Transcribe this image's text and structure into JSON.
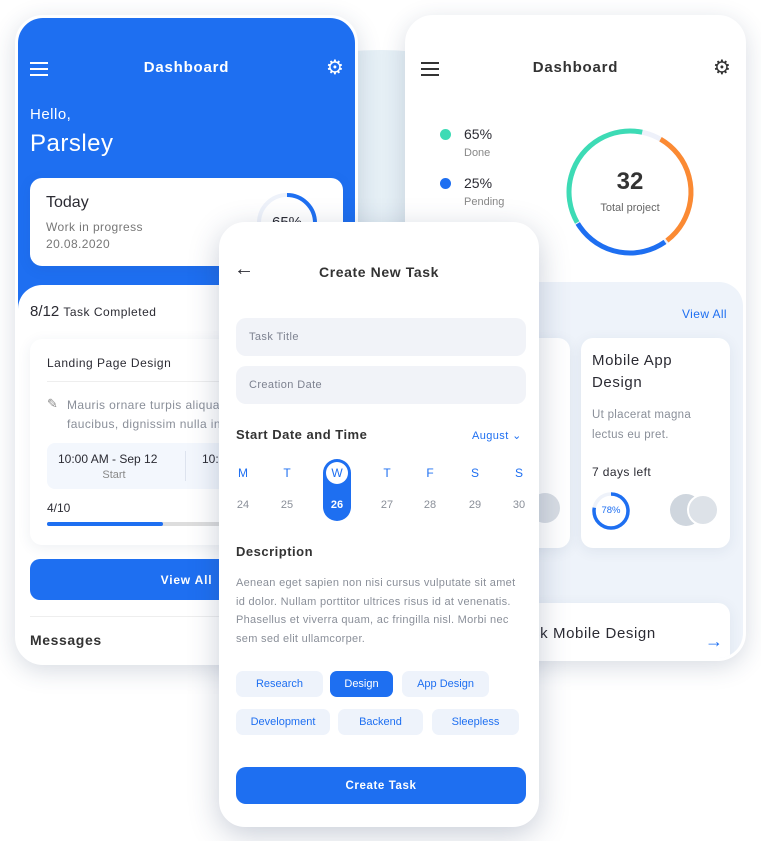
{
  "left": {
    "title": "Dashboard",
    "greeting": "Hello,",
    "name": "Parsley",
    "today": {
      "title": "Today",
      "status": "Work in progress",
      "date": "20.08.2020",
      "percent": "65%",
      "progress": 0.65
    },
    "tasks": {
      "count": "8/12",
      "label": "Task Completed"
    },
    "task_card": {
      "title": "Landing Page Design",
      "desc1": "Mauris ornare turpis aliquam",
      "desc2": "faucibus, dignissim nulla in",
      "start_time": "10:00 AM - Sep 12",
      "start_label": "Start",
      "end_time": "10:",
      "progress_label": "4/10",
      "progress": 0.4
    },
    "view_all": "View All",
    "messages": "Messages"
  },
  "right": {
    "title": "Dashboard",
    "legend": [
      {
        "value": "65%",
        "label": "Done",
        "color": "#3ddbb5"
      },
      {
        "value": "25%",
        "label": "Pending",
        "color": "#1e6ff1"
      }
    ],
    "donut": {
      "total": "32",
      "label": "Total project"
    },
    "view_all": "View All",
    "project": {
      "title": "Mobile App Design",
      "desc": "Ut placerat magna lectus eu pret.",
      "days": "7 days left",
      "percent": "78%",
      "progress": 0.78
    },
    "bottom_card": "ck Mobile Design"
  },
  "create": {
    "title": "Create New Task",
    "task_title_placeholder": "Task Title",
    "creation_date_placeholder": "Creation Date",
    "date_label": "Start Date and Time",
    "month": "August",
    "days": [
      {
        "d": "M",
        "n": "24"
      },
      {
        "d": "T",
        "n": "25"
      },
      {
        "d": "W",
        "n": "26"
      },
      {
        "d": "T",
        "n": "27"
      },
      {
        "d": "F",
        "n": "28"
      },
      {
        "d": "S",
        "n": "29"
      },
      {
        "d": "S",
        "n": "30"
      }
    ],
    "selected_day": "26",
    "description_label": "Description",
    "description": "Aenean eget sapien non nisi cursus vulputate sit amet id dolor. Nullam porttitor ultrices risus id at venenatis. Phasellus et viverra quam, ac fringilla nisl. Morbi nec sem sed elit ullamcorper.",
    "tags": [
      "Research",
      "Design",
      "App Design",
      "Development",
      "Backend",
      "Sleepless"
    ],
    "selected_tag": "Design",
    "submit": "Create Task"
  },
  "colors": {
    "accent": "#1e6ff1",
    "done": "#3ddbb5",
    "orange": "#fb8a33"
  }
}
